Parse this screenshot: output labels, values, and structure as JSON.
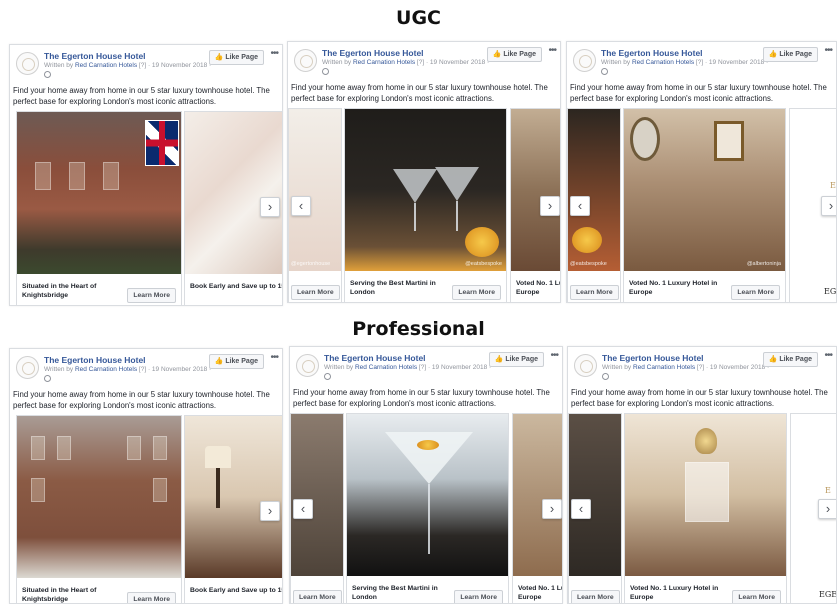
{
  "sections": {
    "ugc_title": "UGC",
    "pro_title": "Professional"
  },
  "ad": {
    "page_name": "The Egerton House Hotel",
    "meta_prefix": "Written by ",
    "meta_brand": "Red Carnation Hotels",
    "meta_suffix": " [?] · 19 November 2018 ·",
    "like_label": "Like Page",
    "more_label": "•••",
    "body_text": "Find your home away from home in our 5 star luxury townhouse hotel. The perfect base for exploring London's most iconic attractions."
  },
  "captions": {
    "knightsbridge": "Situated in the Heart of Knightsbridge",
    "book_early": "Book Early and Save up to 15%",
    "best_martini": "Serving the Best Martini in London",
    "voted_no1": "Voted No. 1 Luxury Hotel in Europe",
    "voted_no1_cut": "Voted No. 1 Lu Europe",
    "learn_more": "Learn More"
  },
  "watermarks": {
    "egerton": "@egertonhouse",
    "bespoke": "@eatsbespoke",
    "albert": "@albertoninja"
  },
  "logo_text": "EGE",
  "logo_gold": "E",
  "arrows": {
    "next": "›",
    "prev": "‹"
  }
}
